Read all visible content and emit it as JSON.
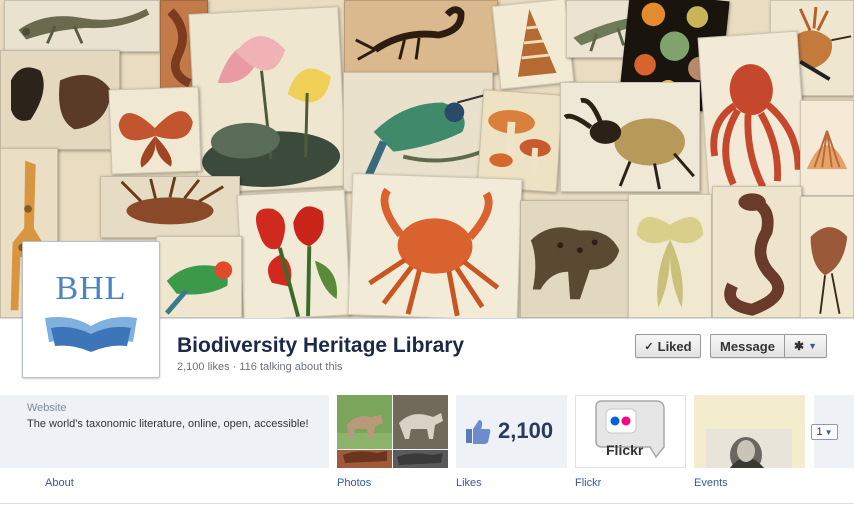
{
  "page": {
    "title": "Biodiversity Heritage Library",
    "stats": "2,100 likes · 116 talking about this",
    "avatar_text": "BHL"
  },
  "actions": {
    "liked_label": "Liked",
    "liked_check": "✓",
    "message_label": "Message",
    "gear_icon": "✱",
    "caret": "▼"
  },
  "about": {
    "heading": "Website",
    "description": "The world's taxonomic literature, online, open, accessible!",
    "label": "About"
  },
  "apps": {
    "photos_label": "Photos",
    "likes_label": "Likes",
    "likes_count": "2,100",
    "flickr_label": "Flickr",
    "flickr_text": "Flickr",
    "events_label": "Events",
    "more_value": "1"
  },
  "colors": {
    "brand_blue": "#3b5998",
    "title_navy": "#1c2a47",
    "bhl_blue": "#4b84c4",
    "tile_bg": "#eef1f6"
  },
  "cover_images": [
    "lizard",
    "lotus",
    "scorpion",
    "shell",
    "crocodile",
    "medusae",
    "hoopoe",
    "mask",
    "tortoise",
    "moth",
    "motmot",
    "mushrooms",
    "beetle",
    "octopus",
    "scallop",
    "giraffe",
    "lionfish",
    "anthurium",
    "crab",
    "leopard",
    "luna-moth",
    "cobra",
    "parrot",
    "bird"
  ]
}
